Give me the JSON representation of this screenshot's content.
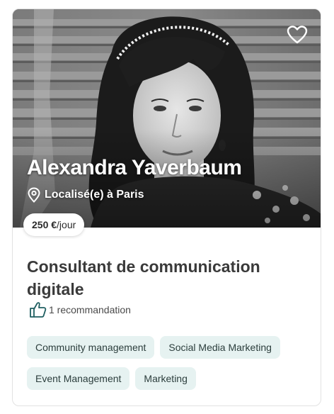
{
  "profile": {
    "name": "Alexandra Yaverbaum",
    "location": "Localisé(e) à Paris",
    "rate_amount": "250 €",
    "rate_unit": "/jour",
    "title": "Consultant de communication digitale",
    "recommendations": "1 recommandation"
  },
  "tags": [
    "Community management",
    "Social Media Marketing",
    "Event Management",
    "Marketing"
  ],
  "icons": {
    "favorite": "heart-icon",
    "location": "map-pin-icon",
    "recommendation": "thumbs-up-icon"
  },
  "colors": {
    "tag_background": "#e6f2f1",
    "thumb_accent": "#1f5f61",
    "title_text": "#3a3a3a"
  }
}
